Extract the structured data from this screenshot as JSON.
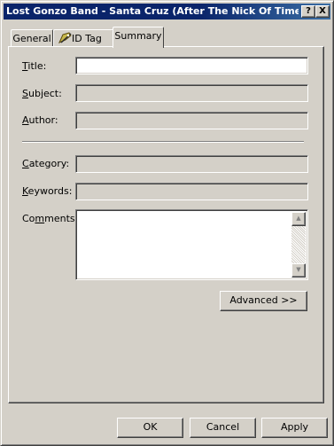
{
  "window": {
    "title": "Lost Gonzo Band - Santa Cruz (After The Nick Of Time).mp..."
  },
  "titlebar_buttons": {
    "help": "?",
    "close": "X"
  },
  "tabs": [
    {
      "label": "General",
      "icon": null
    },
    {
      "label": "ID Tag",
      "icon": "tag-edit-icon"
    },
    {
      "label": "Summary",
      "icon": null,
      "active": true
    }
  ],
  "fields": {
    "title": {
      "label": "Title:",
      "value": ""
    },
    "subject": {
      "label": "Subject:",
      "value": ""
    },
    "author": {
      "label": "Author:",
      "value": ""
    },
    "category": {
      "label": "Category:",
      "value": ""
    },
    "keywords": {
      "label": "Keywords:",
      "value": ""
    },
    "comments": {
      "label": "Comments:",
      "value": ""
    }
  },
  "advanced_label": "Advanced >>",
  "footer": {
    "ok": "OK",
    "cancel": "Cancel",
    "apply": "Apply"
  }
}
